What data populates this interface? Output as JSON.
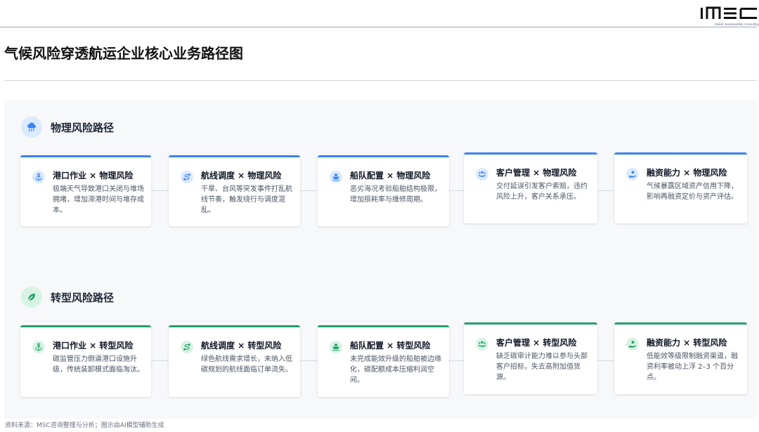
{
  "brand": {
    "logo_text": "MSC",
    "tagline": "Maker Sustainability Consulting"
  },
  "page": {
    "title": "气候风险穿透航运企业核心业务路径图"
  },
  "sections": [
    {
      "title": "物理风险路径",
      "icon": "rain-cloud-icon",
      "accent": "#3b82f6",
      "icon_bg": "#dbeafe",
      "cards": [
        {
          "icon": "anchor-icon",
          "title": "港口作业 × 物理风险",
          "body": "极端天气导致港口关闭与堆场拥堵，增加滞港时间与堆存成本。"
        },
        {
          "icon": "route-icon",
          "title": "航线调度 × 物理风险",
          "body": "干旱、台风等突发事件打乱航线节奏，触发绕行与调度混乱。"
        },
        {
          "icon": "ship-icon",
          "title": "船队配置 × 物理风险",
          "body": "恶劣海况考验船舶结构极限，增加损耗率与维修周期。"
        },
        {
          "icon": "users-icon",
          "title": "客户管理 × 物理风险",
          "body": "交付延误引发客户索赔，违约风险上升，客户关系承压。"
        },
        {
          "icon": "hand-coin-icon",
          "title": "融资能力 × 物理风险",
          "body": "气候暴露区域资产信用下降，影响再融资定价与资产评估。"
        }
      ]
    },
    {
      "title": "转型风险路径",
      "icon": "leaf-icon",
      "accent": "#22a06b",
      "icon_bg": "#d8f3e3",
      "cards": [
        {
          "icon": "anchor-icon",
          "title": "港口作业 × 转型风险",
          "body": "碳监管压力倒逼港口设施升级，传统装卸模式面临淘汰。"
        },
        {
          "icon": "route-icon",
          "title": "航线调度 × 转型风险",
          "body": "绿色航线需求增长，未纳入低碳规划的航线面临订单流失。"
        },
        {
          "icon": "ship-icon",
          "title": "船队配置 × 转型风险",
          "body": "未完成能效升级的船舶被边缘化，碳配额成本压缩利润空间。"
        },
        {
          "icon": "users-icon",
          "title": "客户管理 × 转型风险",
          "body": "缺乏碳审计能力难以参与头部客户招标，失去高附加值货源。"
        },
        {
          "icon": "hand-coin-icon",
          "title": "融资能力 × 转型风险",
          "body": "低能效等级限制融资渠道，融资利率被动上浮 2–3 个百分点。"
        }
      ]
    }
  ],
  "footer": {
    "source": "资料来源：MSC咨询整理与分析；图示由AI模型辅助生成"
  }
}
